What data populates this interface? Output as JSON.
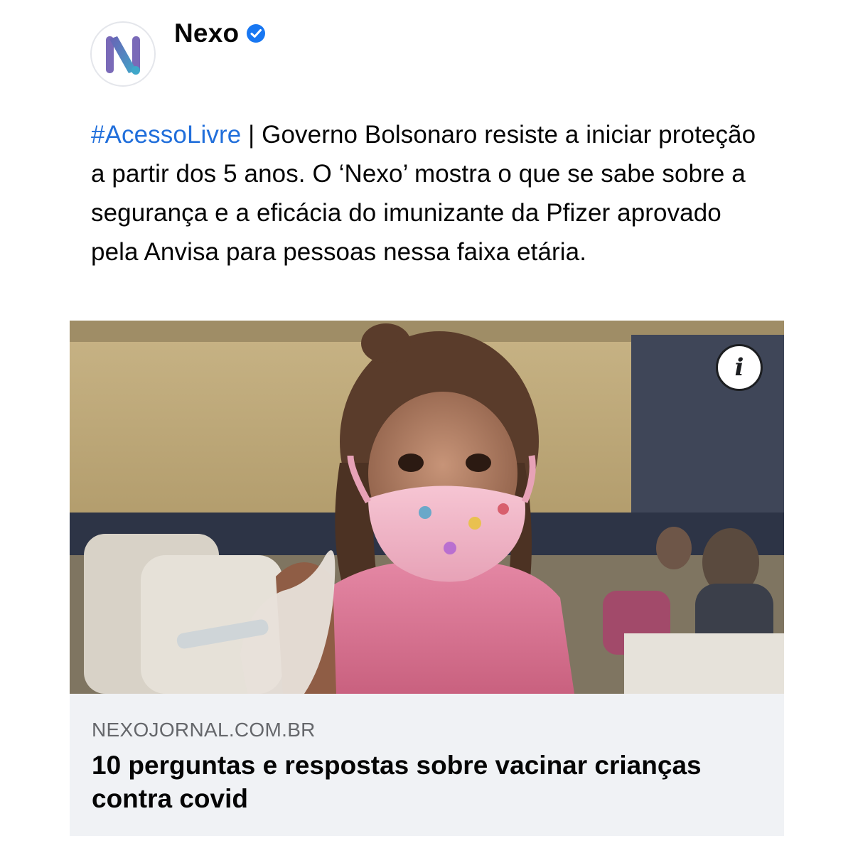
{
  "post": {
    "page_name": "Nexo",
    "verified_icon": "verified-badge-icon",
    "avatar_icon": "nexo-logo-icon",
    "caption_hashtag": "#AcessoLivre",
    "caption_text": " | Governo Bolsonaro resiste a iniciar proteção a partir dos 5 anos. O ‘Nexo’ mostra o que se sabe sobre a segurança e a eficácia do imunizante da Pfizer aprovado pela Anvisa para pessoas nessa faixa etária."
  },
  "link_card": {
    "domain": "NEXOJORNAL.COM.BR",
    "title": "10 perguntas e respostas sobre vacinar crianças contra covid",
    "info_icon": "info-icon",
    "info_glyph": "i"
  },
  "colors": {
    "hashtag": "#216fdb",
    "verified": "#1877f2",
    "card_background": "#f0f2f5"
  }
}
